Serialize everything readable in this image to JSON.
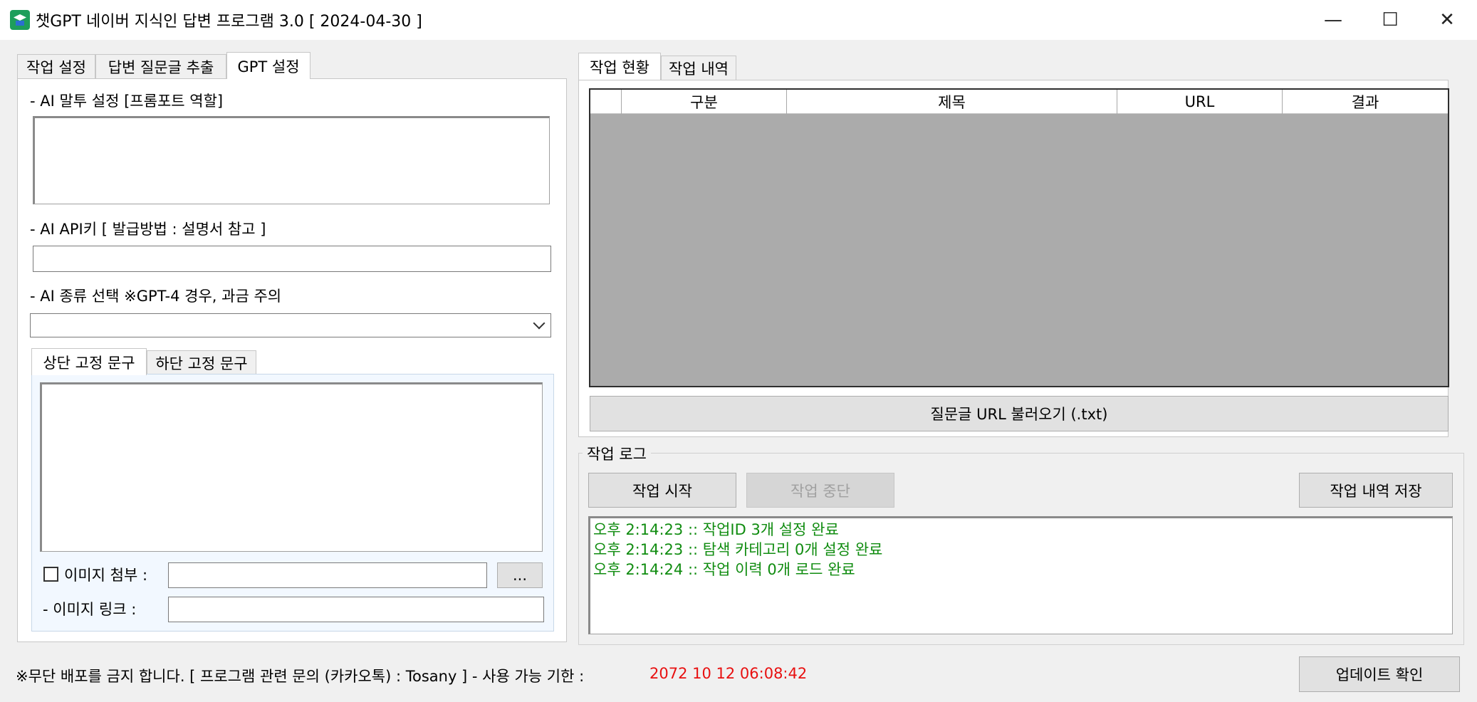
{
  "window": {
    "title": "챗GPT 네이버 지식인 답변 프로그램 3.0 [ 2024-04-30 ]",
    "controls": {
      "minimize": "—",
      "maximize": "☐",
      "close": "✕"
    }
  },
  "left_tabs": [
    "작업 설정",
    "답변 질문글 추출",
    "GPT 설정"
  ],
  "gpt_settings": {
    "tone_label": "- AI 말투 설정 [프롬포트 역할]",
    "tone_value": "",
    "api_label": "- AI API키 [ 발급방법 : 설명서 참고 ]",
    "api_value": "",
    "model_label": "- AI 종류 선택 ※GPT-4 경우, 과금 주의",
    "model_selected": ""
  },
  "phrase_tabs": [
    "상단 고정 문구",
    "하단 고정 문구"
  ],
  "phrase_value": "",
  "image": {
    "attach_label": "이미지 첨부 :",
    "attach_checked": false,
    "attach_value": "",
    "browse_label": "...",
    "link_label": "- 이미지 링크 :",
    "link_value": ""
  },
  "right_tabs": [
    "작업 현황",
    "작업 내역"
  ],
  "grid": {
    "columns": [
      "",
      "구분",
      "제목",
      "URL",
      "결과"
    ],
    "rows": []
  },
  "load_urls_button": "질문글 URL 불러오기 (.txt)",
  "log": {
    "title": "작업 로그",
    "start_button": "작업 시작",
    "stop_button": "작업 중단",
    "save_button": "작업 내역 저장",
    "lines": [
      "오후 2:14:23 :: 작업ID 3개 설정 완료",
      "오후 2:14:23 :: 탐색 카테고리 0개 설정 완료",
      "오후 2:14:24 :: 작업 이력 0개 로드 완료"
    ]
  },
  "footer": {
    "notice": "※무단 배포를 금지 합니다. [ 프로그램 관련 문의 (카카오톡) : Tosany ]   - 사용 가능 기한 :",
    "expiry": "2072 10 12 06:08:42",
    "update_button": "업데이트 확인"
  },
  "colors": {
    "log_text": "#108c10",
    "expiry_text": "#e81010",
    "grid_empty": "#ababab"
  }
}
